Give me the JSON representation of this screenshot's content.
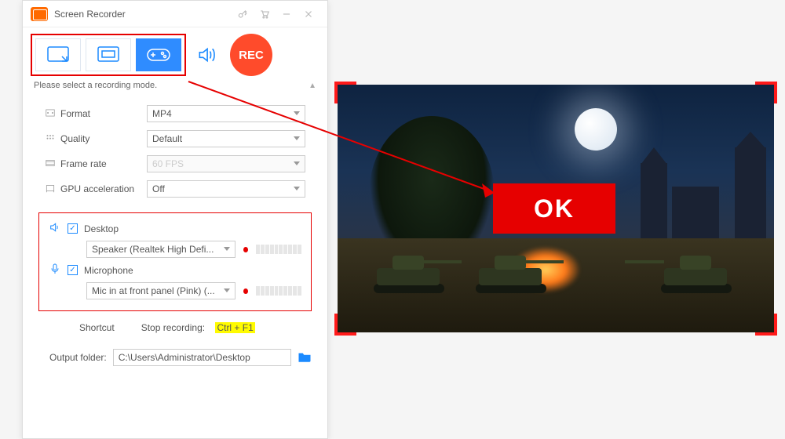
{
  "titlebar": {
    "app_name": "Screen Recorder"
  },
  "modes": {
    "hint": "Please select a recording mode."
  },
  "rec": {
    "label": "REC"
  },
  "settings": {
    "format": {
      "label": "Format",
      "value": "MP4"
    },
    "quality": {
      "label": "Quality",
      "value": "Default"
    },
    "framerate": {
      "label": "Frame rate",
      "value": "60 FPS"
    },
    "gpu": {
      "label": "GPU acceleration",
      "value": "Off"
    }
  },
  "audio": {
    "desktop": {
      "label": "Desktop",
      "device": "Speaker (Realtek High Defi...",
      "checked": true
    },
    "mic": {
      "label": "Microphone",
      "device": "Mic in at front panel (Pink) (...",
      "checked": true
    }
  },
  "shortcut": {
    "label": "Shortcut",
    "stop_label": "Stop recording:",
    "hotkey": "Ctrl + F1"
  },
  "output": {
    "label": "Output folder:",
    "path": "C:\\Users\\Administrator\\Desktop"
  },
  "overlay": {
    "ok": "OK"
  },
  "colors": {
    "accent": "#1b8aff",
    "danger": "#e60000",
    "rec": "#ff4b2b"
  }
}
